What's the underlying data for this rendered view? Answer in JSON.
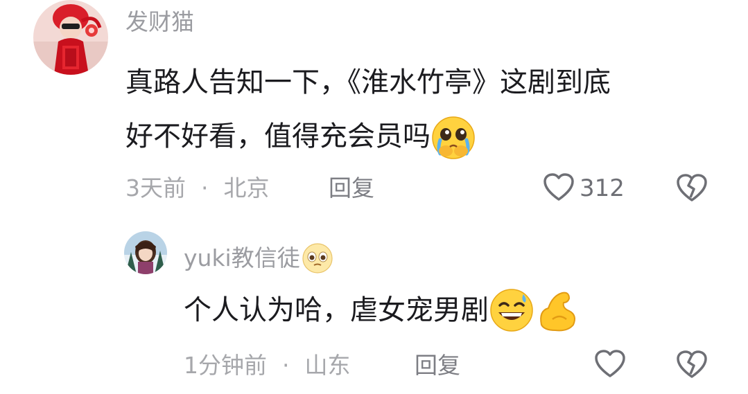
{
  "comments": [
    {
      "username": "发财猫",
      "text_lines": [
        "真路人告知一下，《淮水竹亭》这剧到底",
        "好不好看，值得充会员吗"
      ],
      "emoji_end": "pleading-face-tears-emoji",
      "time": "3天前",
      "separator": "·",
      "location": "北京",
      "reply_label": "回复",
      "like_count": "312",
      "like_icon": "heart-outline-icon",
      "dislike_icon": "broken-heart-icon"
    },
    {
      "username": "yuki教信徒",
      "username_emoji": "pleading-eyes-emoji",
      "text": "个人认为哈，虐女宠男剧",
      "emojis_end": [
        "grinning-sweat-emoji",
        "flexed-biceps-emoji"
      ],
      "time": "1分钟前",
      "separator": "·",
      "location": "山东",
      "reply_label": "回复",
      "like_icon": "heart-outline-icon",
      "dislike_icon": "broken-heart-icon"
    }
  ],
  "colors": {
    "username": "#9b9ca1",
    "text": "#1b1b1f",
    "meta": "#a6a7ab",
    "reply": "#7d7e84",
    "icon": "#6e6f75"
  }
}
